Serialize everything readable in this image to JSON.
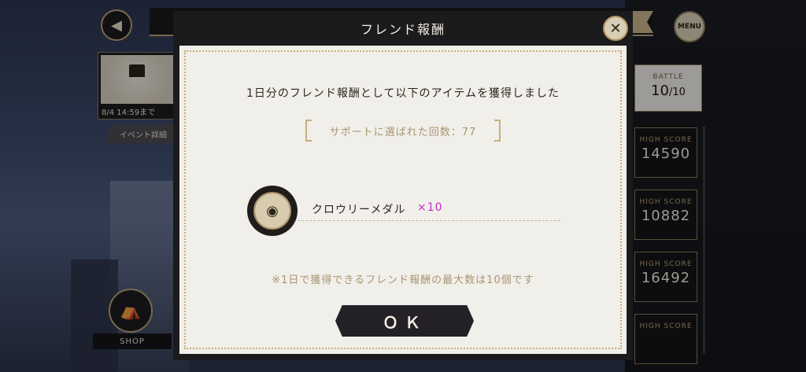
{
  "background": {
    "event_card_date": "8/4 14:59まで",
    "event_detail_label": "イベント詳細",
    "shop_label": "SHOP",
    "menu_label": "MENU",
    "battle": {
      "label": "BATTLE",
      "current": "10",
      "max": "/10"
    },
    "high_scores": [
      {
        "label": "HIGH SCORE",
        "value": "14590"
      },
      {
        "label": "HIGH SCORE",
        "value": "10882"
      },
      {
        "label": "HIGH SCORE",
        "value": "16492"
      },
      {
        "label": "HIGH SCORE",
        "value": ""
      }
    ]
  },
  "dialog": {
    "title": "フレンド報酬",
    "close_icon": "close-icon",
    "message": "1日分のフレンド報酬として以下のアイテムを獲得しました",
    "support_text": "サポートに選ばれた回数：77",
    "item": {
      "name": "クロウリーメダル",
      "quantity": "×10",
      "icon": "medal-icon"
    },
    "note": "※1日で獲得できるフレンド報酬の最大数は10個です",
    "ok_label": "ＯＫ"
  },
  "colors": {
    "accent_gold": "#c9ad7a",
    "quantity_magenta": "#c22fbf",
    "modal_dark": "#1b1a1d",
    "panel_cream": "#f1efea"
  }
}
